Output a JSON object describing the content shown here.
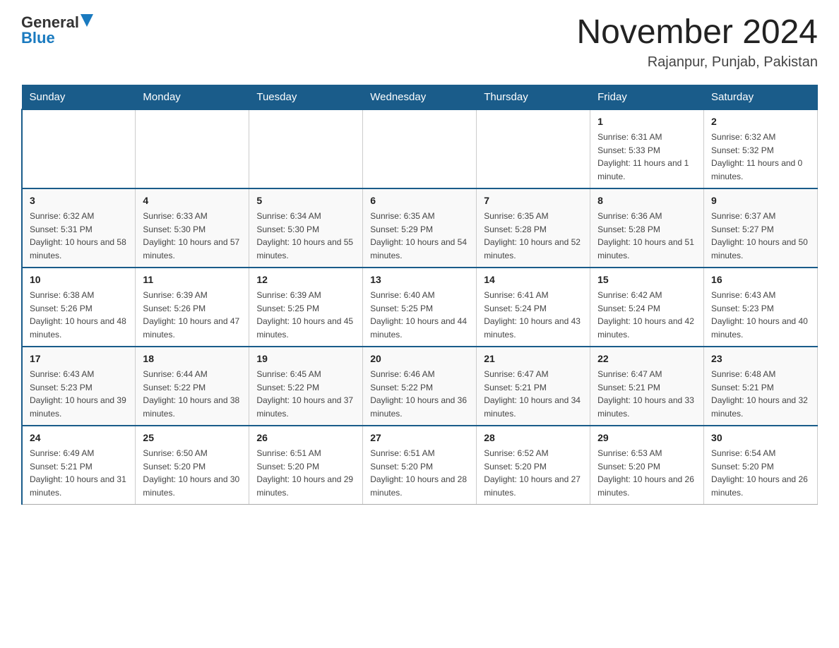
{
  "header": {
    "logo_general": "General",
    "logo_blue": "Blue",
    "month_title": "November 2024",
    "location": "Rajanpur, Punjab, Pakistan"
  },
  "days_of_week": [
    "Sunday",
    "Monday",
    "Tuesday",
    "Wednesday",
    "Thursday",
    "Friday",
    "Saturday"
  ],
  "weeks": [
    [
      {
        "day": "",
        "info": ""
      },
      {
        "day": "",
        "info": ""
      },
      {
        "day": "",
        "info": ""
      },
      {
        "day": "",
        "info": ""
      },
      {
        "day": "",
        "info": ""
      },
      {
        "day": "1",
        "info": "Sunrise: 6:31 AM\nSunset: 5:33 PM\nDaylight: 11 hours and 1 minute."
      },
      {
        "day": "2",
        "info": "Sunrise: 6:32 AM\nSunset: 5:32 PM\nDaylight: 11 hours and 0 minutes."
      }
    ],
    [
      {
        "day": "3",
        "info": "Sunrise: 6:32 AM\nSunset: 5:31 PM\nDaylight: 10 hours and 58 minutes."
      },
      {
        "day": "4",
        "info": "Sunrise: 6:33 AM\nSunset: 5:30 PM\nDaylight: 10 hours and 57 minutes."
      },
      {
        "day": "5",
        "info": "Sunrise: 6:34 AM\nSunset: 5:30 PM\nDaylight: 10 hours and 55 minutes."
      },
      {
        "day": "6",
        "info": "Sunrise: 6:35 AM\nSunset: 5:29 PM\nDaylight: 10 hours and 54 minutes."
      },
      {
        "day": "7",
        "info": "Sunrise: 6:35 AM\nSunset: 5:28 PM\nDaylight: 10 hours and 52 minutes."
      },
      {
        "day": "8",
        "info": "Sunrise: 6:36 AM\nSunset: 5:28 PM\nDaylight: 10 hours and 51 minutes."
      },
      {
        "day": "9",
        "info": "Sunrise: 6:37 AM\nSunset: 5:27 PM\nDaylight: 10 hours and 50 minutes."
      }
    ],
    [
      {
        "day": "10",
        "info": "Sunrise: 6:38 AM\nSunset: 5:26 PM\nDaylight: 10 hours and 48 minutes."
      },
      {
        "day": "11",
        "info": "Sunrise: 6:39 AM\nSunset: 5:26 PM\nDaylight: 10 hours and 47 minutes."
      },
      {
        "day": "12",
        "info": "Sunrise: 6:39 AM\nSunset: 5:25 PM\nDaylight: 10 hours and 45 minutes."
      },
      {
        "day": "13",
        "info": "Sunrise: 6:40 AM\nSunset: 5:25 PM\nDaylight: 10 hours and 44 minutes."
      },
      {
        "day": "14",
        "info": "Sunrise: 6:41 AM\nSunset: 5:24 PM\nDaylight: 10 hours and 43 minutes."
      },
      {
        "day": "15",
        "info": "Sunrise: 6:42 AM\nSunset: 5:24 PM\nDaylight: 10 hours and 42 minutes."
      },
      {
        "day": "16",
        "info": "Sunrise: 6:43 AM\nSunset: 5:23 PM\nDaylight: 10 hours and 40 minutes."
      }
    ],
    [
      {
        "day": "17",
        "info": "Sunrise: 6:43 AM\nSunset: 5:23 PM\nDaylight: 10 hours and 39 minutes."
      },
      {
        "day": "18",
        "info": "Sunrise: 6:44 AM\nSunset: 5:22 PM\nDaylight: 10 hours and 38 minutes."
      },
      {
        "day": "19",
        "info": "Sunrise: 6:45 AM\nSunset: 5:22 PM\nDaylight: 10 hours and 37 minutes."
      },
      {
        "day": "20",
        "info": "Sunrise: 6:46 AM\nSunset: 5:22 PM\nDaylight: 10 hours and 36 minutes."
      },
      {
        "day": "21",
        "info": "Sunrise: 6:47 AM\nSunset: 5:21 PM\nDaylight: 10 hours and 34 minutes."
      },
      {
        "day": "22",
        "info": "Sunrise: 6:47 AM\nSunset: 5:21 PM\nDaylight: 10 hours and 33 minutes."
      },
      {
        "day": "23",
        "info": "Sunrise: 6:48 AM\nSunset: 5:21 PM\nDaylight: 10 hours and 32 minutes."
      }
    ],
    [
      {
        "day": "24",
        "info": "Sunrise: 6:49 AM\nSunset: 5:21 PM\nDaylight: 10 hours and 31 minutes."
      },
      {
        "day": "25",
        "info": "Sunrise: 6:50 AM\nSunset: 5:20 PM\nDaylight: 10 hours and 30 minutes."
      },
      {
        "day": "26",
        "info": "Sunrise: 6:51 AM\nSunset: 5:20 PM\nDaylight: 10 hours and 29 minutes."
      },
      {
        "day": "27",
        "info": "Sunrise: 6:51 AM\nSunset: 5:20 PM\nDaylight: 10 hours and 28 minutes."
      },
      {
        "day": "28",
        "info": "Sunrise: 6:52 AM\nSunset: 5:20 PM\nDaylight: 10 hours and 27 minutes."
      },
      {
        "day": "29",
        "info": "Sunrise: 6:53 AM\nSunset: 5:20 PM\nDaylight: 10 hours and 26 minutes."
      },
      {
        "day": "30",
        "info": "Sunrise: 6:54 AM\nSunset: 5:20 PM\nDaylight: 10 hours and 26 minutes."
      }
    ]
  ]
}
